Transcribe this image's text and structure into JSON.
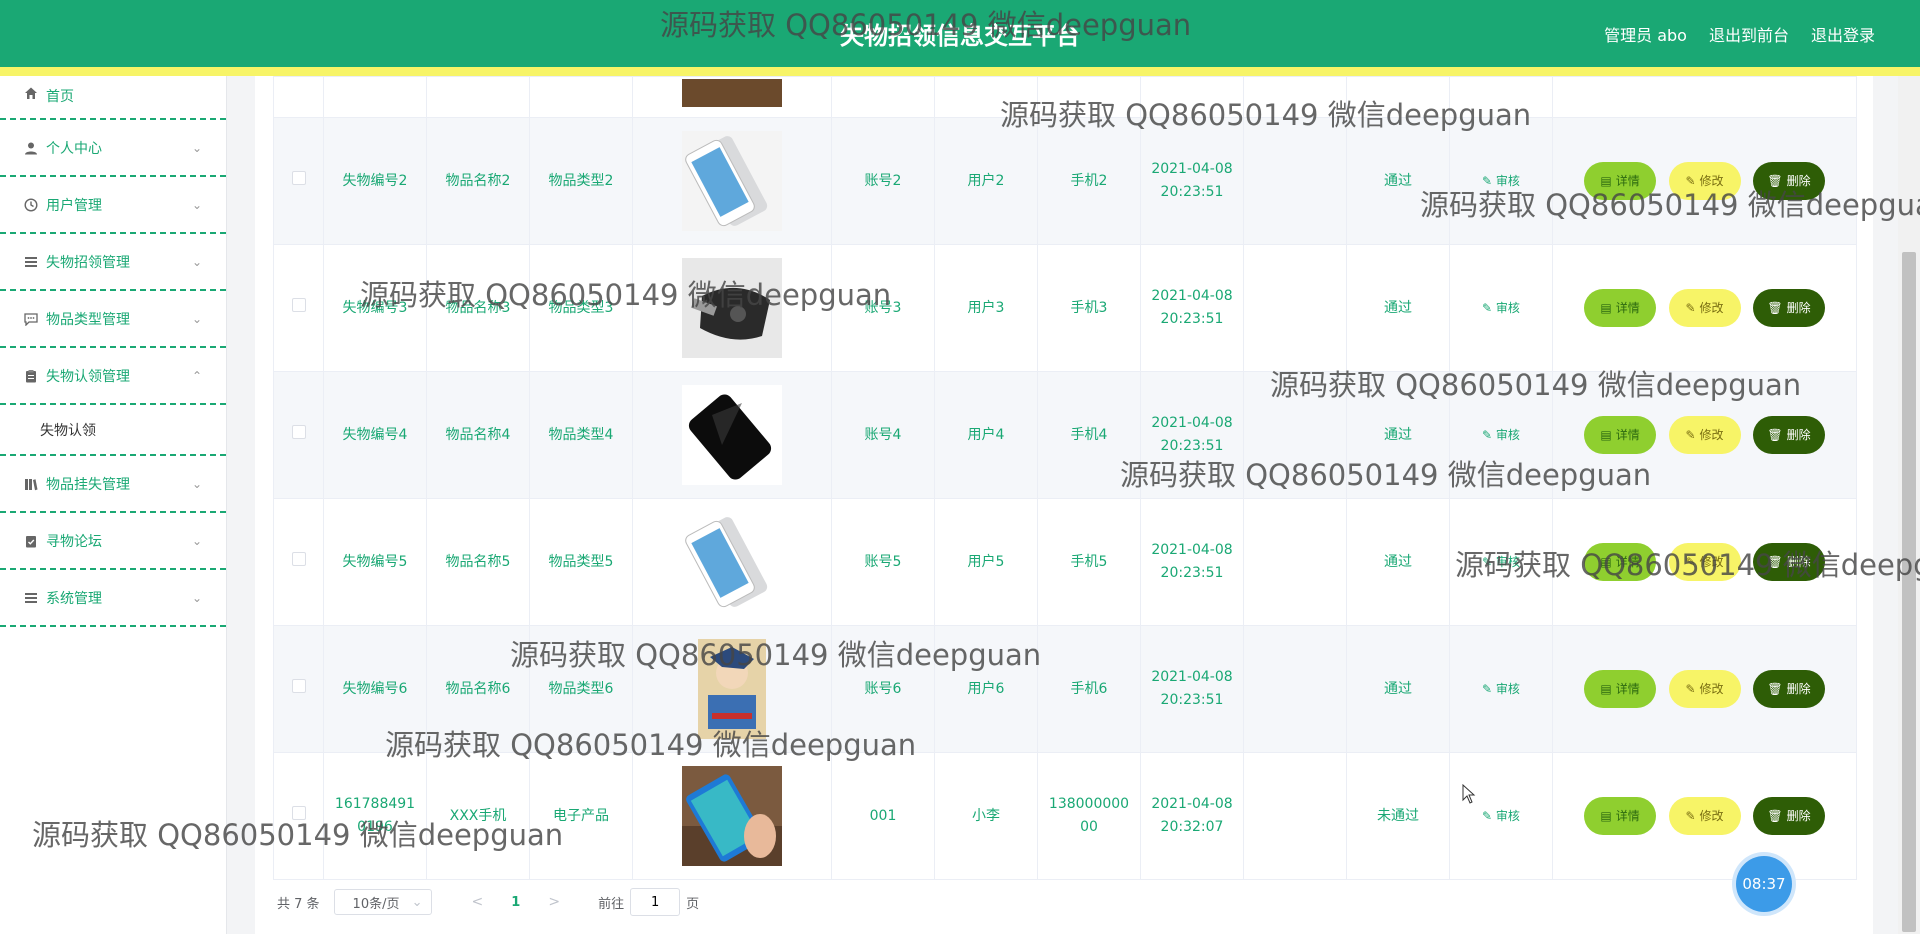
{
  "header": {
    "title": "失物招领信息交互平台",
    "admin_label": "管理员 abo",
    "front_label": "退出到前台",
    "logout_label": "退出登录"
  },
  "sidebar": {
    "items": [
      {
        "label": "首页",
        "icon": "home-icon"
      },
      {
        "label": "个人中心",
        "icon": "user-icon"
      },
      {
        "label": "用户管理",
        "icon": "clock-icon"
      },
      {
        "label": "失物招领管理",
        "icon": "list-icon"
      },
      {
        "label": "物品类型管理",
        "icon": "chat-icon"
      },
      {
        "label": "失物认领管理",
        "icon": "clipboard-icon"
      }
    ],
    "submenu_label": "失物认领",
    "items_after": [
      {
        "label": "物品挂失管理",
        "icon": "books-icon"
      },
      {
        "label": "寻物论坛",
        "icon": "checklist-icon"
      },
      {
        "label": "系统管理",
        "icon": "menu-icon"
      }
    ]
  },
  "table": {
    "rows": [
      {
        "code": "失物编号2",
        "name": "物品名称2",
        "type": "物品类型2",
        "account": "账号2",
        "user": "用户2",
        "phone": "手机2",
        "date": "2021-04-08",
        "time": "20:23:51",
        "status": "通过"
      },
      {
        "code": "失物编号3",
        "name": "物品名称3",
        "type": "物品类型3",
        "account": "账号3",
        "user": "用户3",
        "phone": "手机3",
        "date": "2021-04-08",
        "time": "20:23:51",
        "status": "通过"
      },
      {
        "code": "失物编号4",
        "name": "物品名称4",
        "type": "物品类型4",
        "account": "账号4",
        "user": "用户4",
        "phone": "手机4",
        "date": "2021-04-08",
        "time": "20:23:51",
        "status": "通过"
      },
      {
        "code": "失物编号5",
        "name": "物品名称5",
        "type": "物品类型5",
        "account": "账号5",
        "user": "用户5",
        "phone": "手机5",
        "date": "2021-04-08",
        "time": "20:23:51",
        "status": "通过"
      },
      {
        "code": "失物编号6",
        "name": "物品名称6",
        "type": "物品类型6",
        "account": "账号6",
        "user": "用户6",
        "phone": "手机6",
        "date": "2021-04-08",
        "time": "20:23:51",
        "status": "通过"
      },
      {
        "code": "161788491 0196",
        "name": "XXX手机",
        "type": "电子产品",
        "account": "001",
        "user": "小李",
        "phone": "138000000 00",
        "date": "2021-04-08",
        "time": "20:32:07",
        "status": "未通过"
      }
    ],
    "audit_label": "审核",
    "detail_label": "详情",
    "edit_label": "修改",
    "delete_label": "删除"
  },
  "pagination": {
    "total": "共 7 条",
    "page_size": "10条/页",
    "current_page": "1",
    "goto_prefix": "前往",
    "goto_value": "1",
    "goto_suffix": "页"
  },
  "clock_time": "08:37",
  "watermark": "源码获取 QQ86050149 微信deepguan"
}
